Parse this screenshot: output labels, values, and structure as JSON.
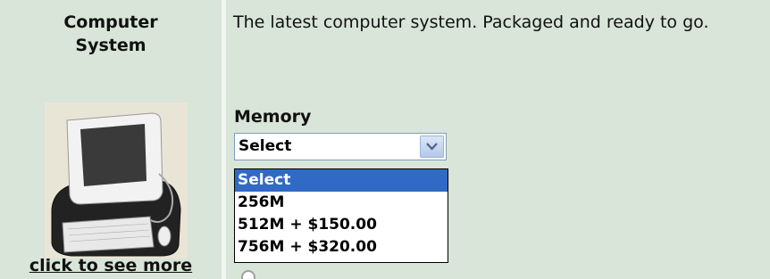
{
  "product": {
    "title": "Computer\nSystem",
    "image_alt": "computer-system-image",
    "see_more_link": "click to see more"
  },
  "details": {
    "description": "The latest computer system. Packaged and ready to go.",
    "memory_label": "Memory",
    "memory_select": {
      "current_value": "Select",
      "options": [
        {
          "label": "Select",
          "selected": true
        },
        {
          "label": "256M",
          "selected": false
        },
        {
          "label": "512M + $150.00",
          "selected": false
        },
        {
          "label": "756M + $320.00",
          "selected": false
        }
      ]
    }
  },
  "colors": {
    "background": "#d8e5d8",
    "highlight": "#316ac5"
  }
}
